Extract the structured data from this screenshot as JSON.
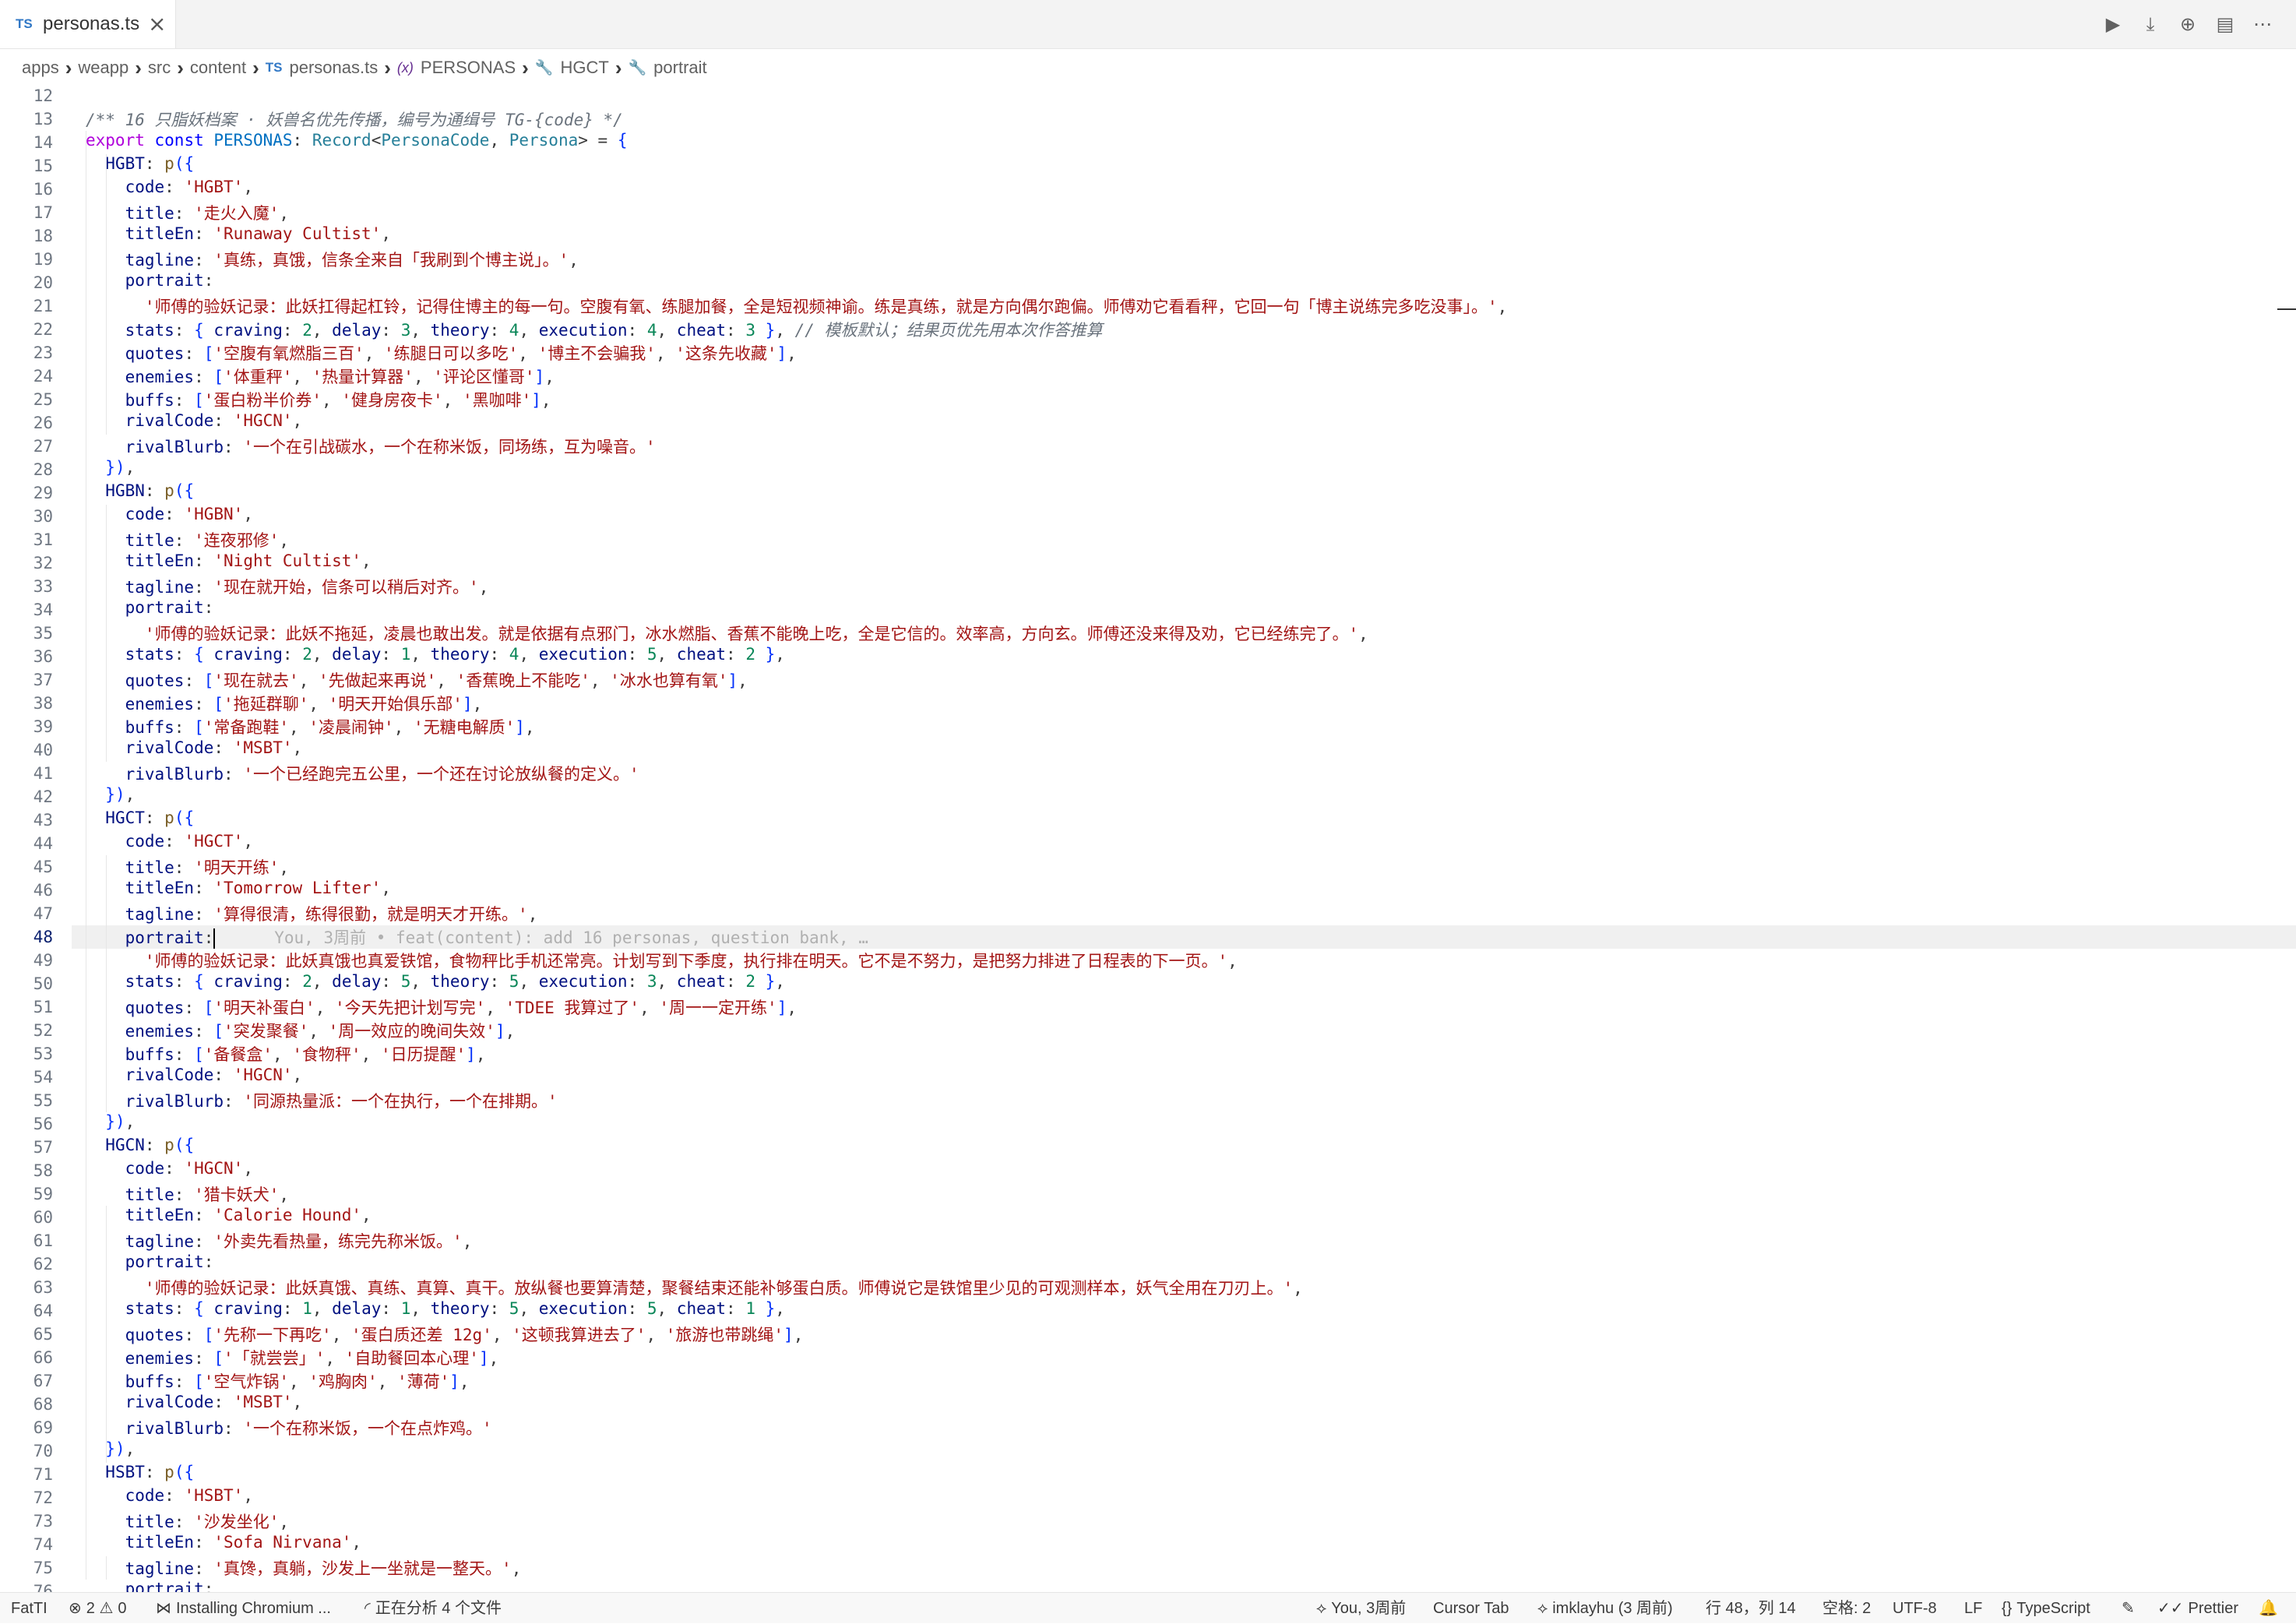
{
  "tab": {
    "badge": "TS",
    "filename": "personas.ts",
    "close": "×"
  },
  "actions": [
    "▶",
    "⤓",
    "⊕",
    "▤",
    "⋯"
  ],
  "breadcrumb": [
    {
      "label": "apps",
      "icon": ""
    },
    {
      "label": "weapp",
      "icon": ""
    },
    {
      "label": "src",
      "icon": ""
    },
    {
      "label": "content",
      "icon": ""
    },
    {
      "label": "personas.ts",
      "icon": "TS",
      "iconKind": "ts"
    },
    {
      "label": "PERSONAS",
      "icon": "(x)",
      "iconKind": "var"
    },
    {
      "label": "HGCT",
      "icon": "🔧",
      "iconKind": "wrench"
    },
    {
      "label": "portrait",
      "icon": "🔧",
      "iconKind": "wrench"
    }
  ],
  "editor": {
    "first_line": 12,
    "active_line": 48,
    "inline_blame": "You, 3周前 • feat(content): add 16 personas, question bank, …",
    "lines": [
      "",
      "/** 16 只脂妖档案 · 妖兽名优先传播，编号为通缉号 TG-{code} */",
      "export const PERSONAS: Record<PersonaCode, Persona> = {",
      "  HGBT: p({",
      "    code: 'HGBT',",
      "    title: '走火入魔',",
      "    titleEn: 'Runaway Cultist',",
      "    tagline: '真练，真饿，信条全来自「我刷到个博主说」。',",
      "    portrait:",
      "      '师傅的验妖记录：此妖扛得起杠铃，记得住博主的每一句。空腹有氧、练腿加餐，全是短视频神谕。练是真练，就是方向偶尔跑偏。师傅劝它看看秤，它回一句「博主说练完多吃没事」。',",
      "    stats: { craving: 2, delay: 3, theory: 4, execution: 4, cheat: 3 }, // 模板默认；结果页优先用本次作答推算",
      "    quotes: ['空腹有氧燃脂三百', '练腿日可以多吃', '博主不会骗我', '这条先收藏'],",
      "    enemies: ['体重秤', '热量计算器', '评论区懂哥'],",
      "    buffs: ['蛋白粉半价券', '健身房夜卡', '黑咖啡'],",
      "    rivalCode: 'HGCN',",
      "    rivalBlurb: '一个在引战碳水，一个在称米饭，同场练，互为噪音。'",
      "  }),",
      "  HGBN: p({",
      "    code: 'HGBN',",
      "    title: '连夜邪修',",
      "    titleEn: 'Night Cultist',",
      "    tagline: '现在就开始，信条可以稍后对齐。',",
      "    portrait:",
      "      '师傅的验妖记录：此妖不拖延，凌晨也敢出发。就是依据有点邪门，冰水燃脂、香蕉不能晚上吃，全是它信的。效率高，方向玄。师傅还没来得及劝，它已经练完了。',",
      "    stats: { craving: 2, delay: 1, theory: 4, execution: 5, cheat: 2 },",
      "    quotes: ['现在就去', '先做起来再说', '香蕉晚上不能吃', '冰水也算有氧'],",
      "    enemies: ['拖延群聊', '明天开始俱乐部'],",
      "    buffs: ['常备跑鞋', '凌晨闹钟', '无糖电解质'],",
      "    rivalCode: 'MSBT',",
      "    rivalBlurb: '一个已经跑完五公里，一个还在讨论放纵餐的定义。'",
      "  }),",
      "  HGCT: p({",
      "    code: 'HGCT',",
      "    title: '明天开练',",
      "    titleEn: 'Tomorrow Lifter',",
      "    tagline: '算得很清，练得很勤，就是明天才开练。',",
      "    portrait:",
      "      '师傅的验妖记录：此妖真饿也真爱铁馆，食物秤比手机还常亮。计划写到下季度，执行排在明天。它不是不努力，是把努力排进了日程表的下一页。',",
      "    stats: { craving: 2, delay: 5, theory: 5, execution: 3, cheat: 2 },",
      "    quotes: ['明天补蛋白', '今天先把计划写完', 'TDEE 我算过了', '周一一定开练'],",
      "    enemies: ['突发聚餐', '周一效应的晚间失效'],",
      "    buffs: ['备餐盒', '食物秤', '日历提醒'],",
      "    rivalCode: 'HGCN',",
      "    rivalBlurb: '同源热量派：一个在执行，一个在排期。'",
      "  }),",
      "  HGCN: p({",
      "    code: 'HGCN',",
      "    title: '猎卡妖犬',",
      "    titleEn: 'Calorie Hound',",
      "    tagline: '外卖先看热量，练完先称米饭。',",
      "    portrait:",
      "      '师傅的验妖记录：此妖真饿、真练、真算、真干。放纵餐也要算清楚，聚餐结束还能补够蛋白质。师傅说它是铁馆里少见的可观测样本，妖气全用在刀刃上。',",
      "    stats: { craving: 1, delay: 1, theory: 5, execution: 5, cheat: 1 },",
      "    quotes: ['先称一下再吃', '蛋白质还差 12g', '这顿我算进去了', '旅游也带跳绳'],",
      "    enemies: ['「就尝尝」', '自助餐回本心理'],",
      "    buffs: ['空气炸锅', '鸡胸肉', '薄荷'],",
      "    rivalCode: 'MSBT',",
      "    rivalBlurb: '一个在称米饭，一个在点炸鸡。'",
      "  }),",
      "  HSBT: p({",
      "    code: 'HSBT',",
      "    title: '沙发坐化',",
      "    titleEn: 'Sofa Nirvana',",
      "    tagline: '真馋，真躺，沙发上一坐就是一整天。',",
      "    portrait:"
    ]
  },
  "statusbar": {
    "left": [
      {
        "label": "FatTI",
        "icon": ""
      },
      {
        "label": "2",
        "icon": "⊗"
      },
      {
        "label": "0",
        "icon": "⚠"
      },
      {
        "label": "Installing Chromium ...",
        "icon": "⋈"
      },
      {
        "label": "正在分析 4 个文件",
        "icon": "◜"
      }
    ],
    "right": [
      {
        "label": "You, 3周前",
        "icon": "⟡"
      },
      {
        "label": "Cursor Tab",
        "icon": ""
      },
      {
        "label": "imklayhu (3 周前)",
        "icon": "⟡"
      },
      {
        "label": "行 48，列 14",
        "icon": ""
      },
      {
        "label": "空格: 2",
        "icon": ""
      },
      {
        "label": "UTF-8",
        "icon": ""
      },
      {
        "label": "LF",
        "icon": ""
      },
      {
        "label": "TypeScript",
        "icon": "{}"
      },
      {
        "label": "",
        "icon": "✎"
      },
      {
        "label": "Prettier",
        "icon": "✓✓"
      },
      {
        "label": "",
        "icon": "🔔"
      }
    ]
  }
}
